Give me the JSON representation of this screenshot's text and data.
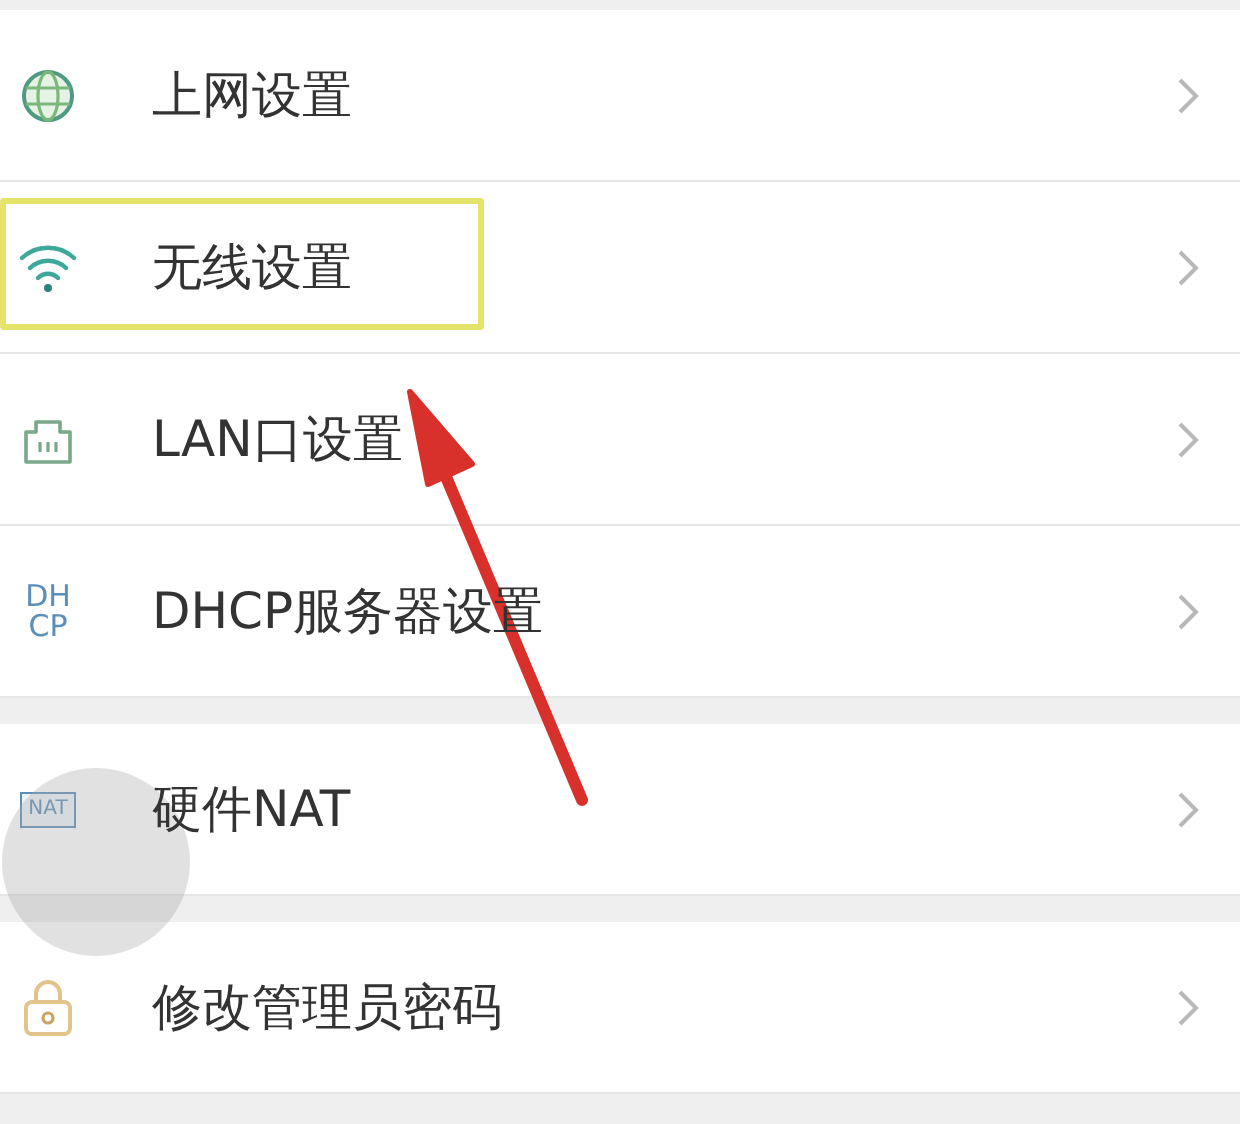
{
  "groups": [
    {
      "items": [
        {
          "kind": "globe",
          "label": "上网设置",
          "highlighted": false
        },
        {
          "kind": "wifi",
          "label": "无线设置",
          "highlighted": true
        },
        {
          "kind": "lan",
          "label": "LAN口设置",
          "highlighted": false
        },
        {
          "kind": "dhcp",
          "icon_text": [
            "DH",
            "CP"
          ],
          "label": "DHCP服务器设置",
          "highlighted": false
        }
      ]
    },
    {
      "items": [
        {
          "kind": "nat",
          "icon_text": [
            "NAT"
          ],
          "label": "硬件NAT",
          "highlighted": false
        }
      ]
    },
    {
      "items": [
        {
          "kind": "lock",
          "label": "修改管理员密码",
          "highlighted": false
        }
      ]
    }
  ],
  "pointer_arrow": true,
  "floating_button": true
}
